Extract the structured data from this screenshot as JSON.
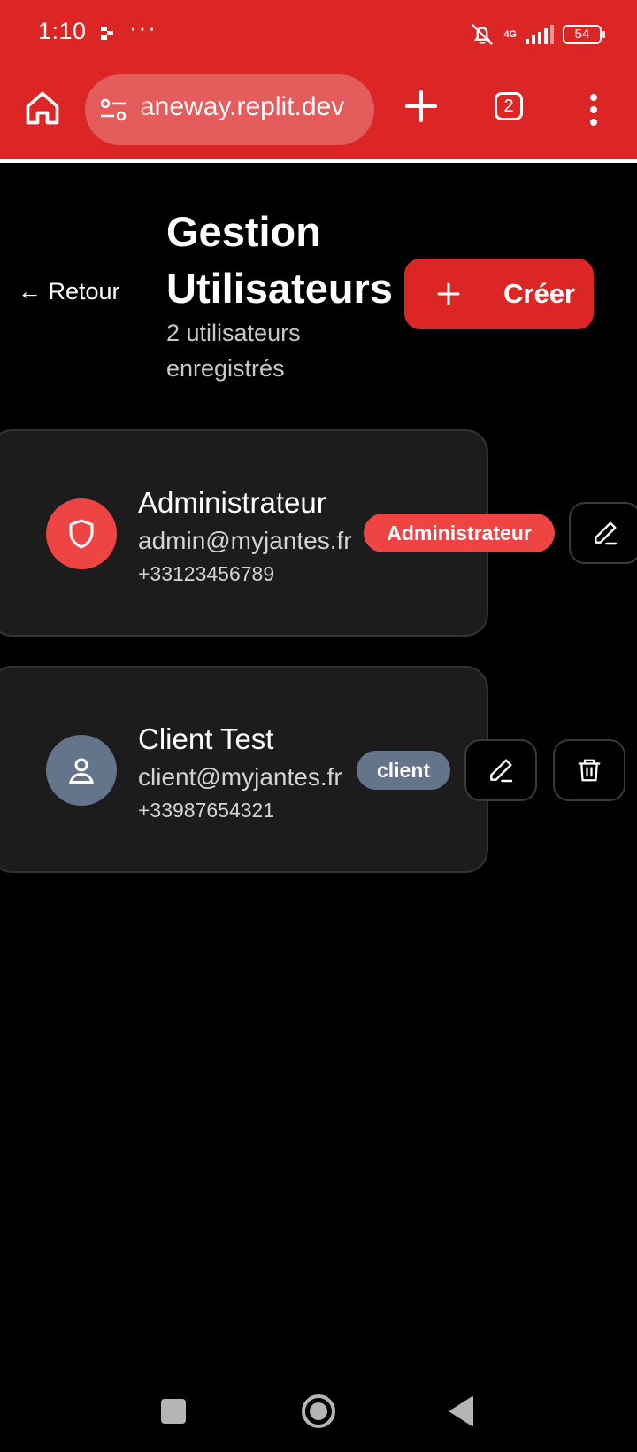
{
  "status_bar": {
    "time": "1:10",
    "dots": "···",
    "network": "4G",
    "battery": "54"
  },
  "browser": {
    "url": "aneway.replit.dev",
    "tab_count": "2"
  },
  "header": {
    "back_label": "← Retour",
    "title": "Gestion Utilisateurs",
    "subtitle": "2 utilisateurs enregistrés",
    "create_label": "Créer"
  },
  "users": [
    {
      "name": "Administrateur",
      "email": "admin@myjantes.fr",
      "phone": "+33123456789",
      "role": "Administrateur",
      "avatar_icon": "shield-icon",
      "color": "#ef4444"
    },
    {
      "name": "Client Test",
      "email": "client@myjantes.fr",
      "phone": "+33987654321",
      "role": "client",
      "avatar_icon": "user-icon",
      "color": "#64748b"
    }
  ],
  "colors": {
    "brand": "#dc2626",
    "background": "#000000",
    "card": "#1c1c1c"
  }
}
